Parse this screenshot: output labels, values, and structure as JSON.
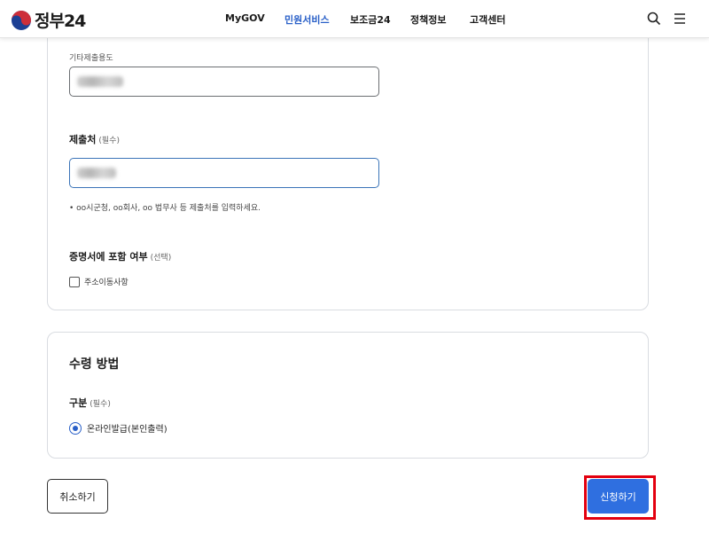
{
  "header": {
    "logo_text": "정부24",
    "nav": [
      {
        "label": "MyGOV"
      },
      {
        "label": "민원서비스"
      },
      {
        "label": "보조금24"
      },
      {
        "label": "정책정보"
      },
      {
        "label": "고객센터"
      }
    ],
    "active_nav": "민원서비스",
    "icons": [
      "search-icon",
      "menu-icon"
    ]
  },
  "form": {
    "other_purpose": {
      "label": "기타제출용도",
      "value": ""
    },
    "submit_to": {
      "title": "제출처",
      "required": "(필수)",
      "value": "",
      "hint": "• oo시군청, oo회사, oo 법무사 등 제출처를 입력하세요."
    },
    "include": {
      "title": "증명서에 포함 여부",
      "optional": "(선택)",
      "checkbox_label": "주소이동사항",
      "checked": false
    }
  },
  "receipt": {
    "title": "수령 방법",
    "type_title": "구분",
    "type_required": "(필수)",
    "option_label": "온라인발급(본인출력)",
    "selected": true
  },
  "actions": {
    "cancel": "취소하기",
    "submit": "신청하기"
  },
  "colors": {
    "accent": "#2f6fe0",
    "highlight": "#e3000f",
    "active_nav": "#2a60c8"
  }
}
